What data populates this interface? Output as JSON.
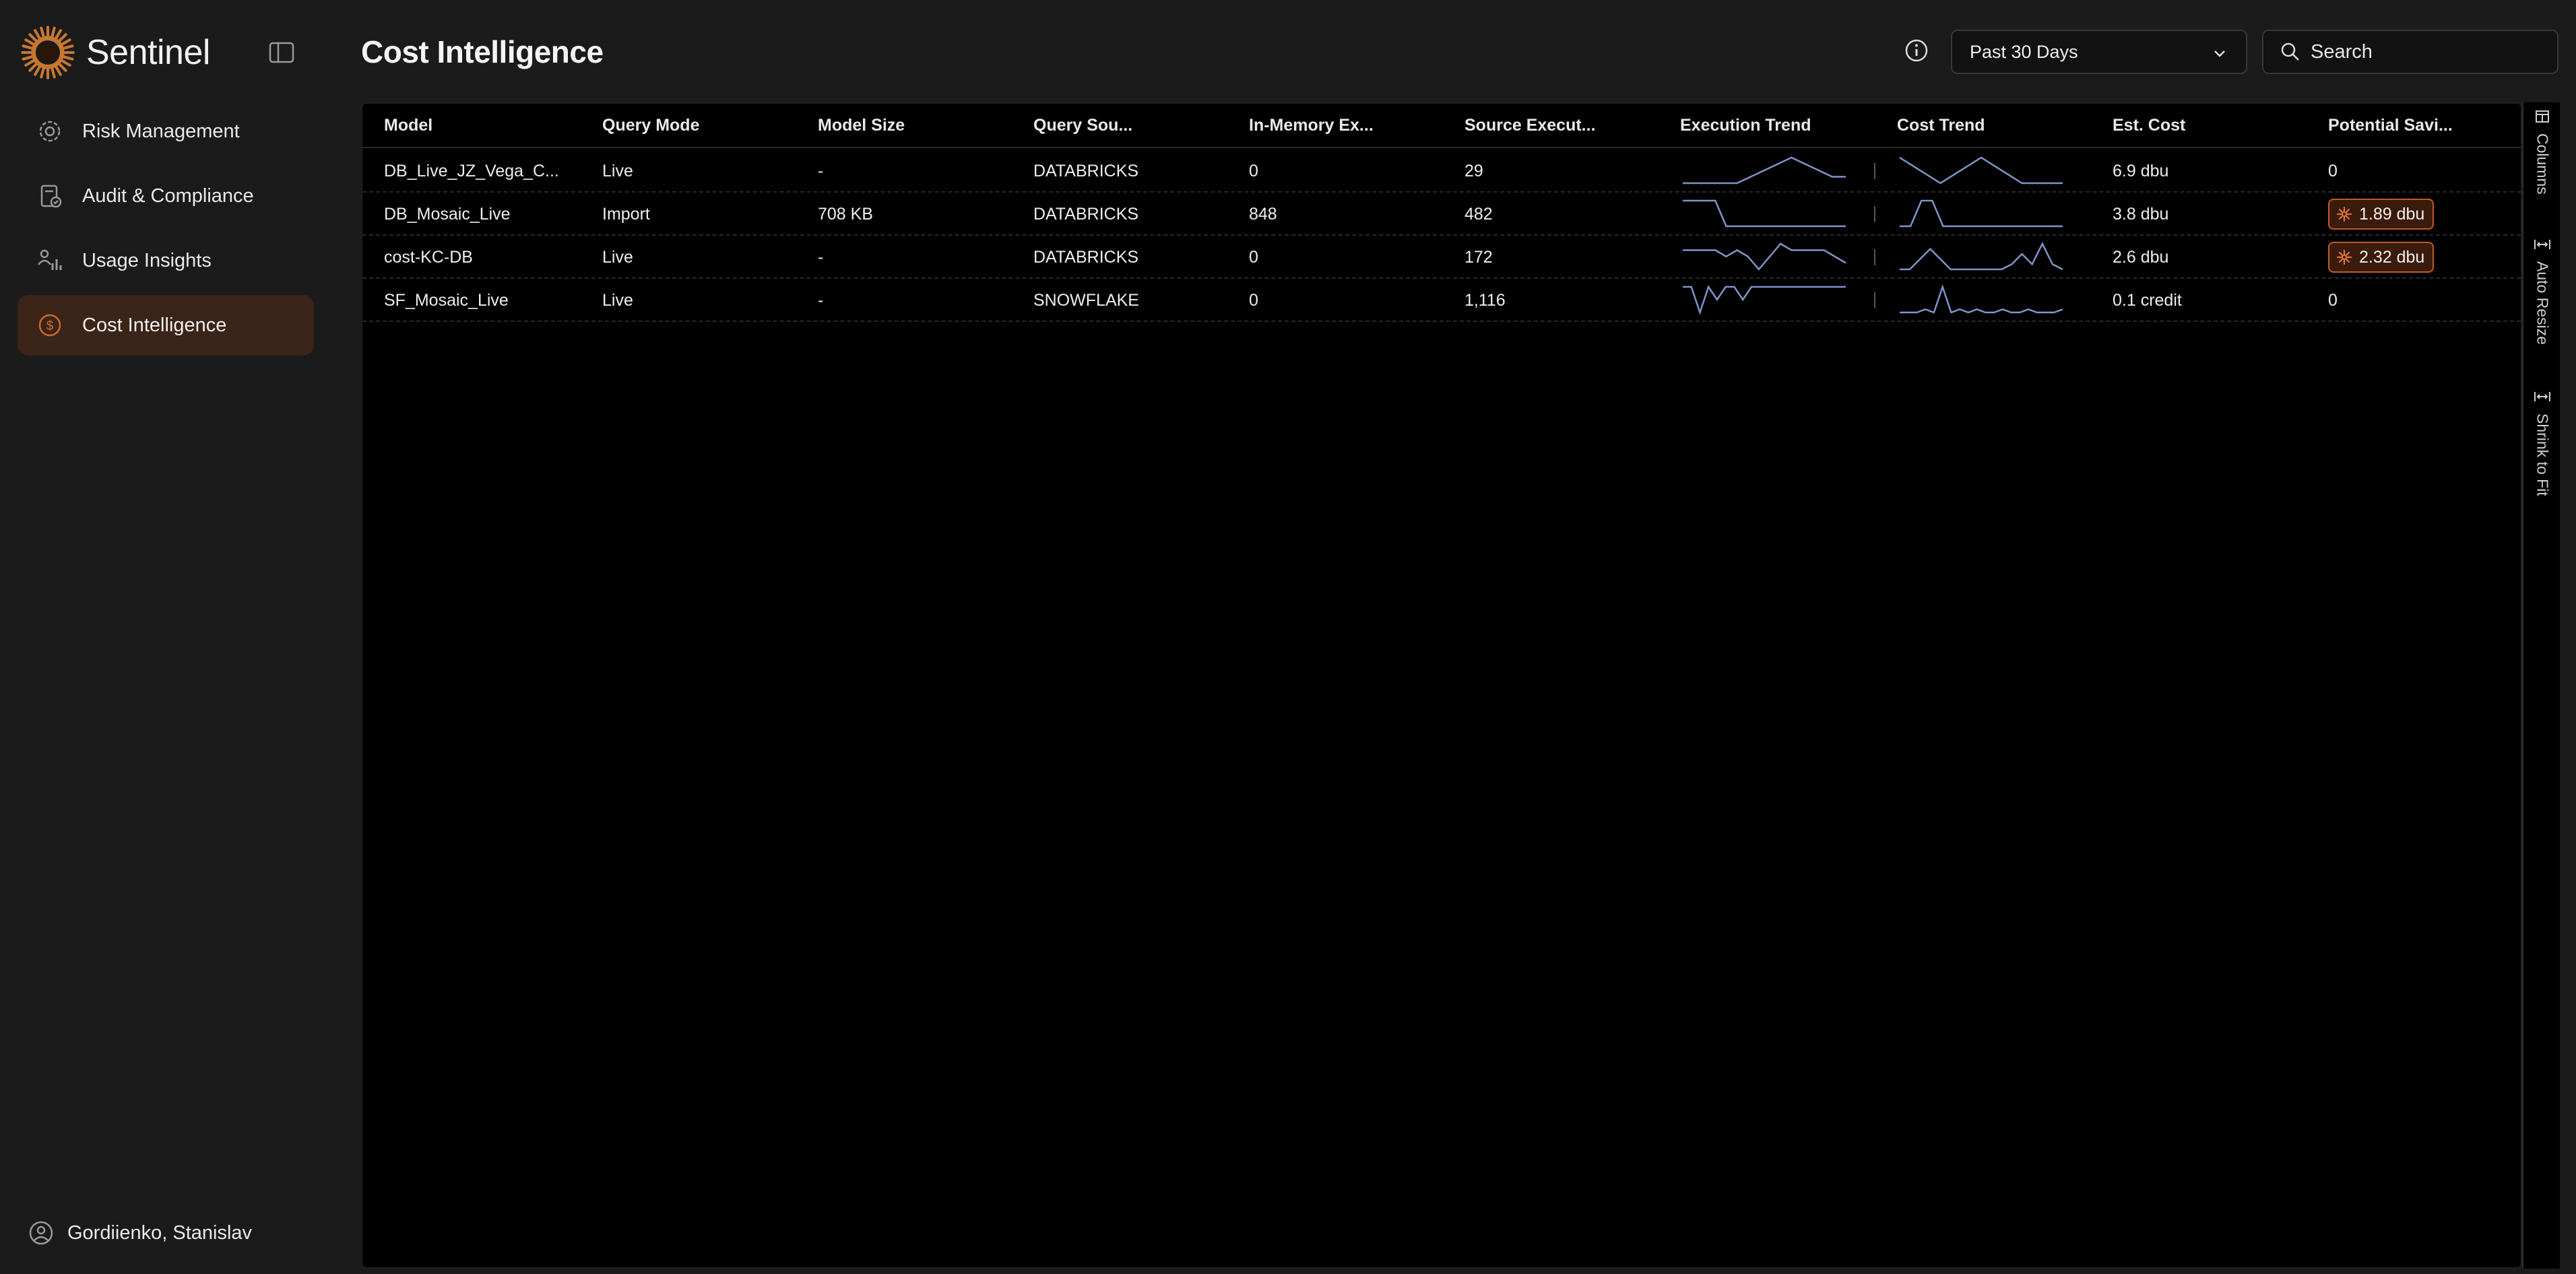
{
  "app": {
    "name": "Sentinel"
  },
  "sidebar": {
    "items": [
      {
        "label": "Risk Management",
        "icon": "gear-shield-icon"
      },
      {
        "label": "Audit & Compliance",
        "icon": "clipboard-check-icon"
      },
      {
        "label": "Usage Insights",
        "icon": "user-chart-icon"
      },
      {
        "label": "Cost Intelligence",
        "icon": "dollar-coin-icon",
        "active": true
      }
    ],
    "user": "Gordiienko, Stanislav"
  },
  "header": {
    "title": "Cost Intelligence",
    "date_range": "Past 30 Days",
    "search_placeholder": "Search"
  },
  "table": {
    "columns": [
      "Model",
      "Query Mode",
      "Model Size",
      "Query Sou...",
      "In-Memory Ex...",
      "Source Execut...",
      "Execution Trend",
      "Cost Trend",
      "Est. Cost",
      "Potential Savi..."
    ],
    "rows": [
      {
        "model": "DB_Live_JZ_Vega_C...",
        "query_mode": "Live",
        "model_size": "-",
        "query_source": "DATABRICKS",
        "in_memory": "0",
        "source_exec": "29",
        "exec_trend": [
          5,
          5,
          5,
          5,
          5,
          6,
          7,
          8,
          9,
          8,
          7,
          6,
          6
        ],
        "cost_trend": [
          9,
          7,
          5,
          3,
          5,
          7,
          9,
          7,
          5,
          3,
          3,
          3,
          3
        ],
        "est_cost": "6.9 dbu",
        "savings": "0",
        "savings_flag": false
      },
      {
        "model": "DB_Mosaic_Live",
        "query_mode": "Import",
        "model_size": "708 KB",
        "query_source": "DATABRICKS",
        "in_memory": "848",
        "source_exec": "482",
        "exec_trend": [
          10,
          10,
          10,
          10,
          2,
          2,
          2,
          2,
          2,
          2,
          2,
          2,
          2,
          2,
          2,
          2
        ],
        "cost_trend": [
          2,
          2,
          9,
          9,
          2,
          2,
          2,
          2,
          2,
          2,
          2,
          2,
          2,
          2,
          2,
          2
        ],
        "est_cost": "3.8 dbu",
        "savings": "1.89 dbu",
        "savings_flag": true
      },
      {
        "model": "cost-KC-DB",
        "query_mode": "Live",
        "model_size": "-",
        "query_source": "DATABRICKS",
        "in_memory": "0",
        "source_exec": "172",
        "exec_trend": [
          6,
          6,
          6,
          6,
          5,
          6,
          5,
          3,
          5,
          7,
          6,
          6,
          6,
          6,
          5,
          4
        ],
        "cost_trend": [
          3,
          3,
          5,
          7,
          5,
          3,
          3,
          3,
          3,
          3,
          3,
          4,
          6,
          4,
          8,
          4,
          3
        ],
        "est_cost": "2.6 dbu",
        "savings": "2.32 dbu",
        "savings_flag": true
      },
      {
        "model": "SF_Mosaic_Live",
        "query_mode": "Live",
        "model_size": "-",
        "query_source": "SNOWFLAKE",
        "in_memory": "0",
        "source_exec": "1,116",
        "exec_trend": [
          6,
          6,
          4,
          6,
          5,
          6,
          6,
          5,
          6,
          6,
          6,
          6,
          6,
          6,
          6,
          6,
          6,
          6,
          6,
          6
        ],
        "cost_trend": [
          2,
          2,
          2,
          3,
          2,
          10,
          2,
          3,
          2,
          3,
          2,
          2,
          3,
          2,
          2,
          3,
          2,
          2,
          2,
          3
        ],
        "est_cost": "0.1 credit",
        "savings": "0",
        "savings_flag": false
      }
    ]
  },
  "tool_panel": [
    "Columns",
    "Auto Resize",
    "Shrink to Fit"
  ],
  "colors": {
    "accent": "#c86a2c",
    "active_nav_bg": "#3b2418",
    "sparkline": "#7f94c8",
    "badge_border": "#c35a22"
  }
}
